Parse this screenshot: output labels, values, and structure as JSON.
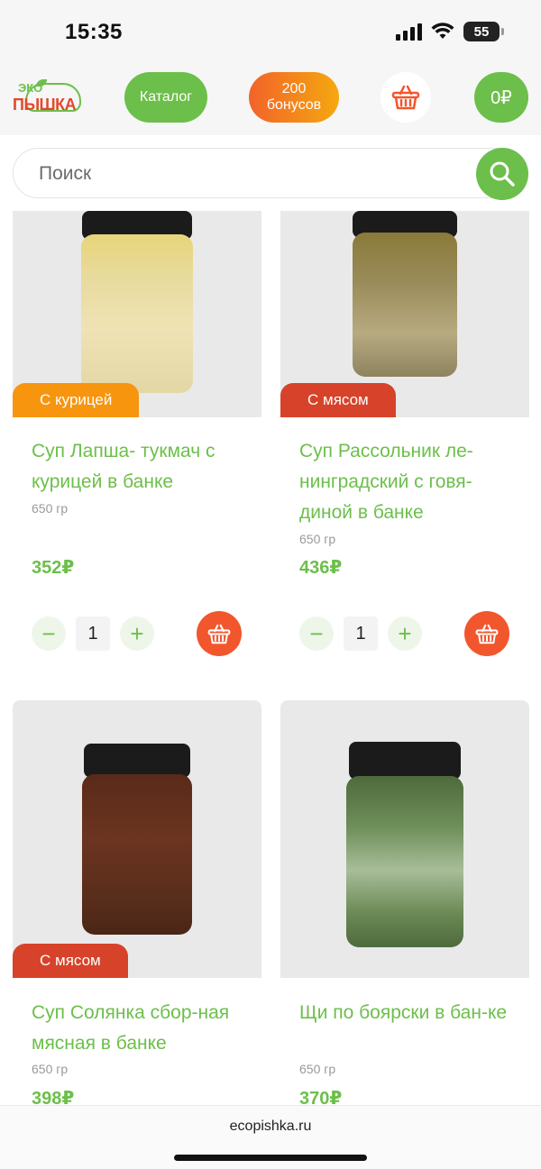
{
  "status_bar": {
    "time": "15:35",
    "battery": "55"
  },
  "header": {
    "logo_top": "ЭКО",
    "logo_main": "ПЫШКА",
    "catalog_label": "Каталог",
    "bonus_amount": "200",
    "bonus_label": "бонусов",
    "cart_total": "0₽",
    "accent_green": "#6cbf4a",
    "accent_orange": "#f2562d"
  },
  "search": {
    "placeholder": "Поиск",
    "value": ""
  },
  "products": [
    {
      "badge": "С курицей",
      "title": "Суп Лапша- тукмач с курицей в банке",
      "weight": "650 гр",
      "price": "352₽",
      "qty": "1"
    },
    {
      "badge": "С мясом",
      "title": "Суп Рассольник ле-нинградский с говя-диной в банке",
      "weight": "650 гр",
      "price": "436₽",
      "qty": "1"
    },
    {
      "badge": "С мясом",
      "title": "Суп Солянка сбор-ная мясная в банке",
      "weight": "650 гр",
      "price": "398₽"
    },
    {
      "badge": "",
      "title": "Щи по боярски в бан-ке",
      "weight": "650 гр",
      "price": "370₽"
    }
  ],
  "qty_controls": {
    "minus": "−",
    "plus": "+"
  },
  "browser": {
    "url": "ecopishka.ru"
  }
}
